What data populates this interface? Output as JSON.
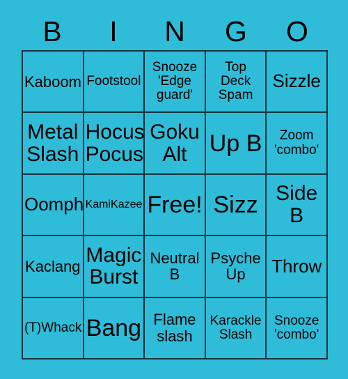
{
  "card": {
    "title": "BINGO",
    "background_color": "#2fbcd8",
    "grid_line_color": "#15343f",
    "text_color": "#000000",
    "header_letters": [
      "B",
      "I",
      "N",
      "G",
      "O"
    ],
    "rows": 5,
    "columns": 5,
    "cells": [
      [
        {
          "text": "Kaboom",
          "size": "m"
        },
        {
          "text": "Footstool",
          "size": "s"
        },
        {
          "text": "Snooze\n'Edge\nguard'",
          "size": "s"
        },
        {
          "text": "Top\nDeck\nSpam",
          "size": "s"
        },
        {
          "text": "Sizzle",
          "size": "l"
        }
      ],
      [
        {
          "text": "Metal\nSlash",
          "size": "xl"
        },
        {
          "text": "Hocus\nPocus",
          "size": "xl"
        },
        {
          "text": "Goku\nAlt",
          "size": "xl"
        },
        {
          "text": "Up B",
          "size": "xxl"
        },
        {
          "text": "Zoom\n'combo'",
          "size": "s"
        }
      ],
      [
        {
          "text": "Oomph",
          "size": "l"
        },
        {
          "text": "KamiKazee",
          "size": "xs"
        },
        {
          "text": "Free!",
          "size": "xxl"
        },
        {
          "text": "Sizz",
          "size": "xxl"
        },
        {
          "text": "Side\nB",
          "size": "xl"
        }
      ],
      [
        {
          "text": "Kaclang",
          "size": "m"
        },
        {
          "text": "Magic\nBurst",
          "size": "xl"
        },
        {
          "text": "Neutral\nB",
          "size": "m"
        },
        {
          "text": "Psyche\nUp",
          "size": "m"
        },
        {
          "text": "Throw",
          "size": "l"
        }
      ],
      [
        {
          "text": "(T)Whack",
          "size": "s"
        },
        {
          "text": "Bang",
          "size": "xxl"
        },
        {
          "text": "Flame\nslash",
          "size": "m"
        },
        {
          "text": "Karackle\nSlash",
          "size": "s"
        },
        {
          "text": "Snooze\n'combo'",
          "size": "s"
        }
      ]
    ]
  }
}
